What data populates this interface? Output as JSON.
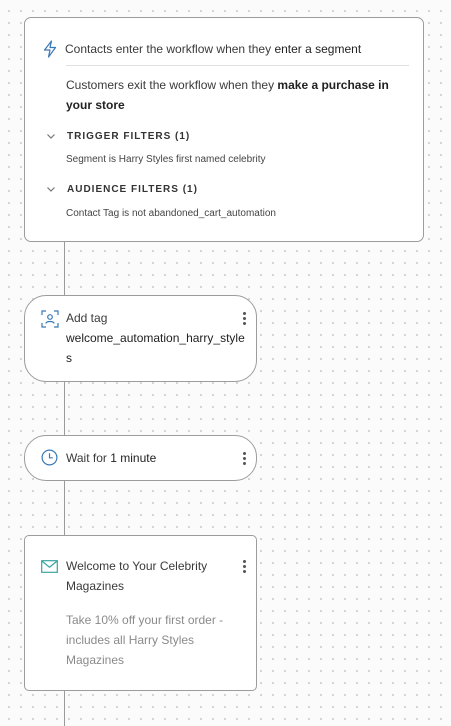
{
  "trigger": {
    "entry_prefix": "Contacts enter the workflow when they ",
    "entry_condition": "enter a segment",
    "exit_prefix": "Customers exit the workflow when they ",
    "exit_condition": "make a purchase in your store",
    "trigger_filters": {
      "title": "TRIGGER FILTERS (1)",
      "detail": "Segment is Harry Styles first named celebrity"
    },
    "audience_filters": {
      "title": "AUDIENCE FILTERS (1)",
      "detail": "Contact Tag is not abandoned_cart_automation"
    }
  },
  "tag_step": {
    "label": "Add tag",
    "value": "welcome_automation_harry_styles",
    "icon": "tag-person-icon"
  },
  "wait_step": {
    "prefix": "Wait for ",
    "duration": "1 minute",
    "icon": "clock-icon"
  },
  "email_step": {
    "subject": "Welcome to Your Celebrity Magazines",
    "preview": "Take 10% off your first order - includes all Harry Styles Magazines",
    "icon": "envelope-icon"
  },
  "colors": {
    "accent": "#3a78b5",
    "card_border": "#9c9c9c",
    "connector": "#9a9a9a"
  }
}
